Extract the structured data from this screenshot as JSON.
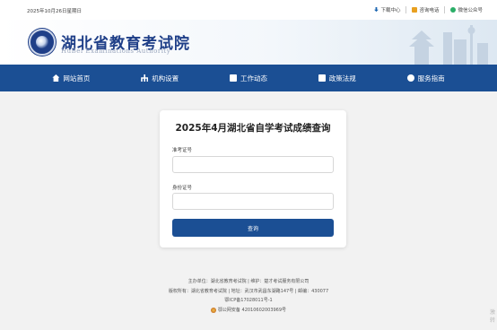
{
  "topbar": {
    "date": "2025年10月26日星期日",
    "links": [
      {
        "label": "下载中心",
        "icon": "download-icon"
      },
      {
        "label": "咨询电话",
        "icon": "phone-icon"
      },
      {
        "label": "微信公众号",
        "icon": "wechat-icon"
      }
    ]
  },
  "header": {
    "title_cn": "湖北省教育考试院",
    "title_en": "HuBei Examinations Authority"
  },
  "nav": [
    {
      "label": "网站首页",
      "icon": "home-icon"
    },
    {
      "label": "机构设置",
      "icon": "org-icon"
    },
    {
      "label": "工作动态",
      "icon": "news-icon"
    },
    {
      "label": "政策法规",
      "icon": "law-icon"
    },
    {
      "label": "服务指南",
      "icon": "guide-icon"
    }
  ],
  "form": {
    "title": "2025年4月湖北省自学考试成绩查询",
    "exam_id_label": "准考证号",
    "exam_id_value": "",
    "id_card_label": "身份证号",
    "id_card_value": "",
    "submit_label": "查询"
  },
  "footer": {
    "line1": "主办单位：湖北省教育考试院 | 维护：楚才考试服务有限公司",
    "line2": "版权所有：湖北省教育考试院 | 地址：武汉市武昌东湖路147号 | 邮编：430077",
    "line3": "鄂ICP备17028011号-1",
    "line4": "鄂公网安备 42010602003969号"
  },
  "watermark": {
    "line1": "激",
    "line2": "转"
  },
  "colors": {
    "brand_blue": "#1b4f94",
    "title_blue": "#1f3f88",
    "page_bg": "#f2f2f2"
  }
}
